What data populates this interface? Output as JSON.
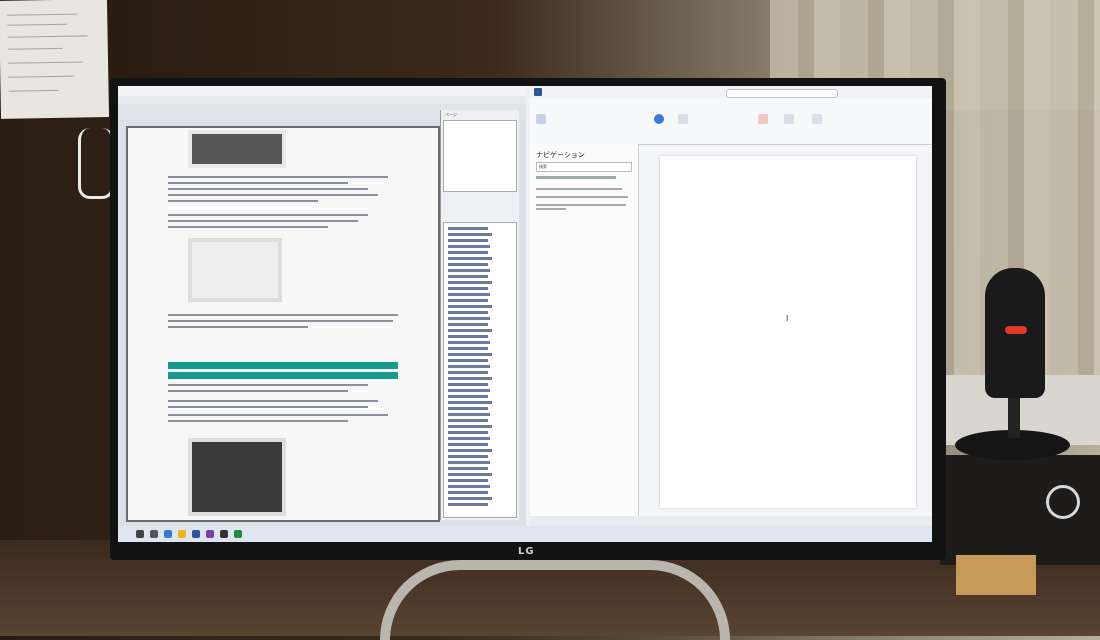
{
  "monitor": {
    "brand": "LG"
  },
  "left_window": {
    "side_pane_title": "ページ"
  },
  "right_window": {
    "navigation_title": "ナビゲーション",
    "search_placeholder": "検索"
  },
  "colors": {
    "teal_heading": "#169a8e",
    "word_accent": "#2b579a",
    "mic_led": "#e23a2a"
  }
}
